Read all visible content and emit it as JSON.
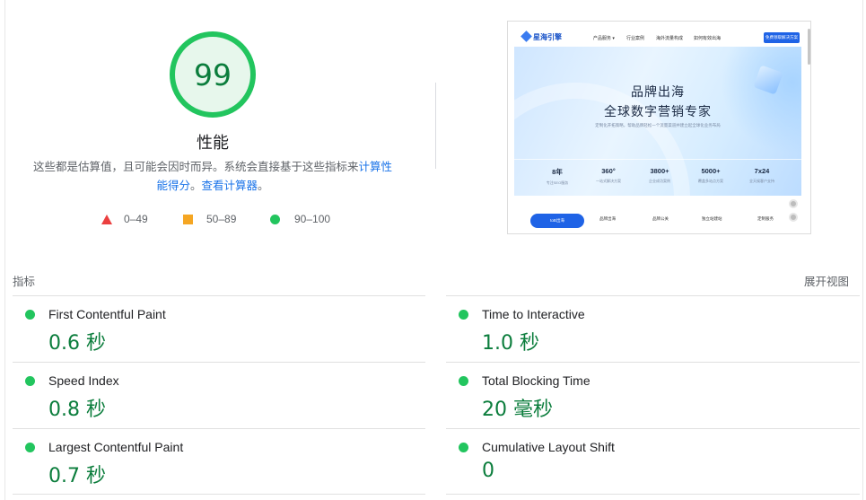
{
  "score": {
    "value": "99",
    "title": "性能",
    "description": "这些都是估算值，且可能会因时而异。系统会直接基于这些指标来",
    "link": "计算性能得分",
    "period": "。",
    "calculator_link": "查看计算器",
    "end_period": "。"
  },
  "legend": [
    {
      "icon": "triangle-icon",
      "label": "0–49",
      "color": "#eb3f3f"
    },
    {
      "icon": "square-icon",
      "label": "50–89",
      "color": "#f5a623"
    },
    {
      "icon": "circle-icon",
      "label": "90–100",
      "color": "#22c55e"
    }
  ],
  "thumbnail": {
    "logo": "星海引擎",
    "nav": [
      "产品服务 ▾",
      "行业案例",
      "海外流量构成",
      "如何有效出海"
    ],
    "nav_button": "免费领取解决方案",
    "headline_1": "品牌出海",
    "headline_2": "全球数字营销专家",
    "subtitle": "定制化开拓策略，帮助品牌轻松一个流量渠道并建立起全球化业务布局",
    "stats": [
      {
        "value": "8年",
        "label": "专注SEO服务"
      },
      {
        "value": "360°",
        "label": "一站式解决方案"
      },
      {
        "value": "3800+",
        "label": "企业成功案例"
      },
      {
        "value": "5000+",
        "label": "覆盖多站点方案"
      },
      {
        "value": "7x24",
        "label": "全天候客户支持"
      }
    ],
    "tabs": [
      "toB出海",
      "品牌出海",
      "品牌公关",
      "独立站建站",
      "定制服务"
    ]
  },
  "metrics": {
    "label": "指标",
    "expand": "展开视图",
    "items": [
      {
        "name": "First Contentful Paint",
        "value": "0.6 秒",
        "status_color": "#22c55e"
      },
      {
        "name": "Time to Interactive",
        "value": "1.0 秒",
        "status_color": "#22c55e"
      },
      {
        "name": "Speed Index",
        "value": "0.8 秒",
        "status_color": "#22c55e"
      },
      {
        "name": "Total Blocking Time",
        "value": "20 毫秒",
        "status_color": "#22c55e"
      },
      {
        "name": "Largest Contentful Paint",
        "value": "0.7 秒",
        "status_color": "#22c55e"
      },
      {
        "name": "Cumulative Layout Shift",
        "value": "0",
        "status_color": "#22c55e"
      }
    ]
  },
  "colors": {
    "pass": "#0b7d3c",
    "pass_ring": "#22c55e",
    "link": "#1a73e8"
  }
}
